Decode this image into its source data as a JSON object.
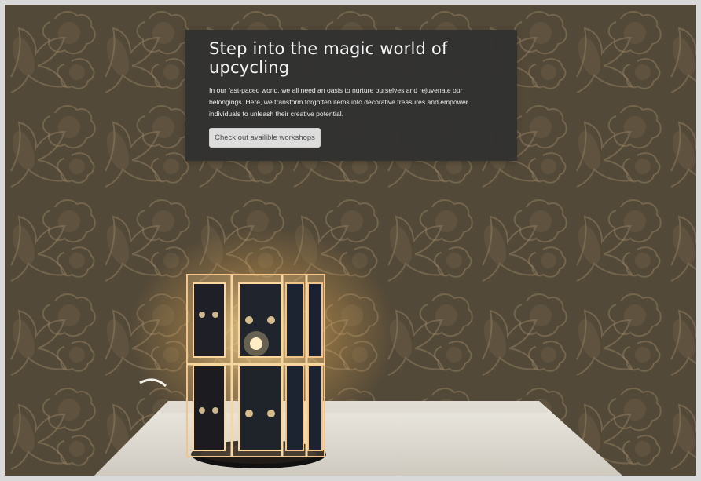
{
  "hero": {
    "title": "Step into the magic world of upcycling",
    "description": "In our fast-paced world, we all need an oasis to nurture ourselves and rejuvenate our belongings. Here, we transform forgotten items into decorative treasures and empower individuals to unleash their creative potential.",
    "button_label": "Check out availible workshops"
  },
  "image": {
    "subject": "cassette-tape-lamp",
    "background": "floral-wallpaper",
    "surface": "white-table"
  },
  "colors": {
    "page_frame": "#d9d9d9",
    "card_background": "#313131",
    "button_background": "#dddddd",
    "text_light": "#f5f5f5"
  }
}
